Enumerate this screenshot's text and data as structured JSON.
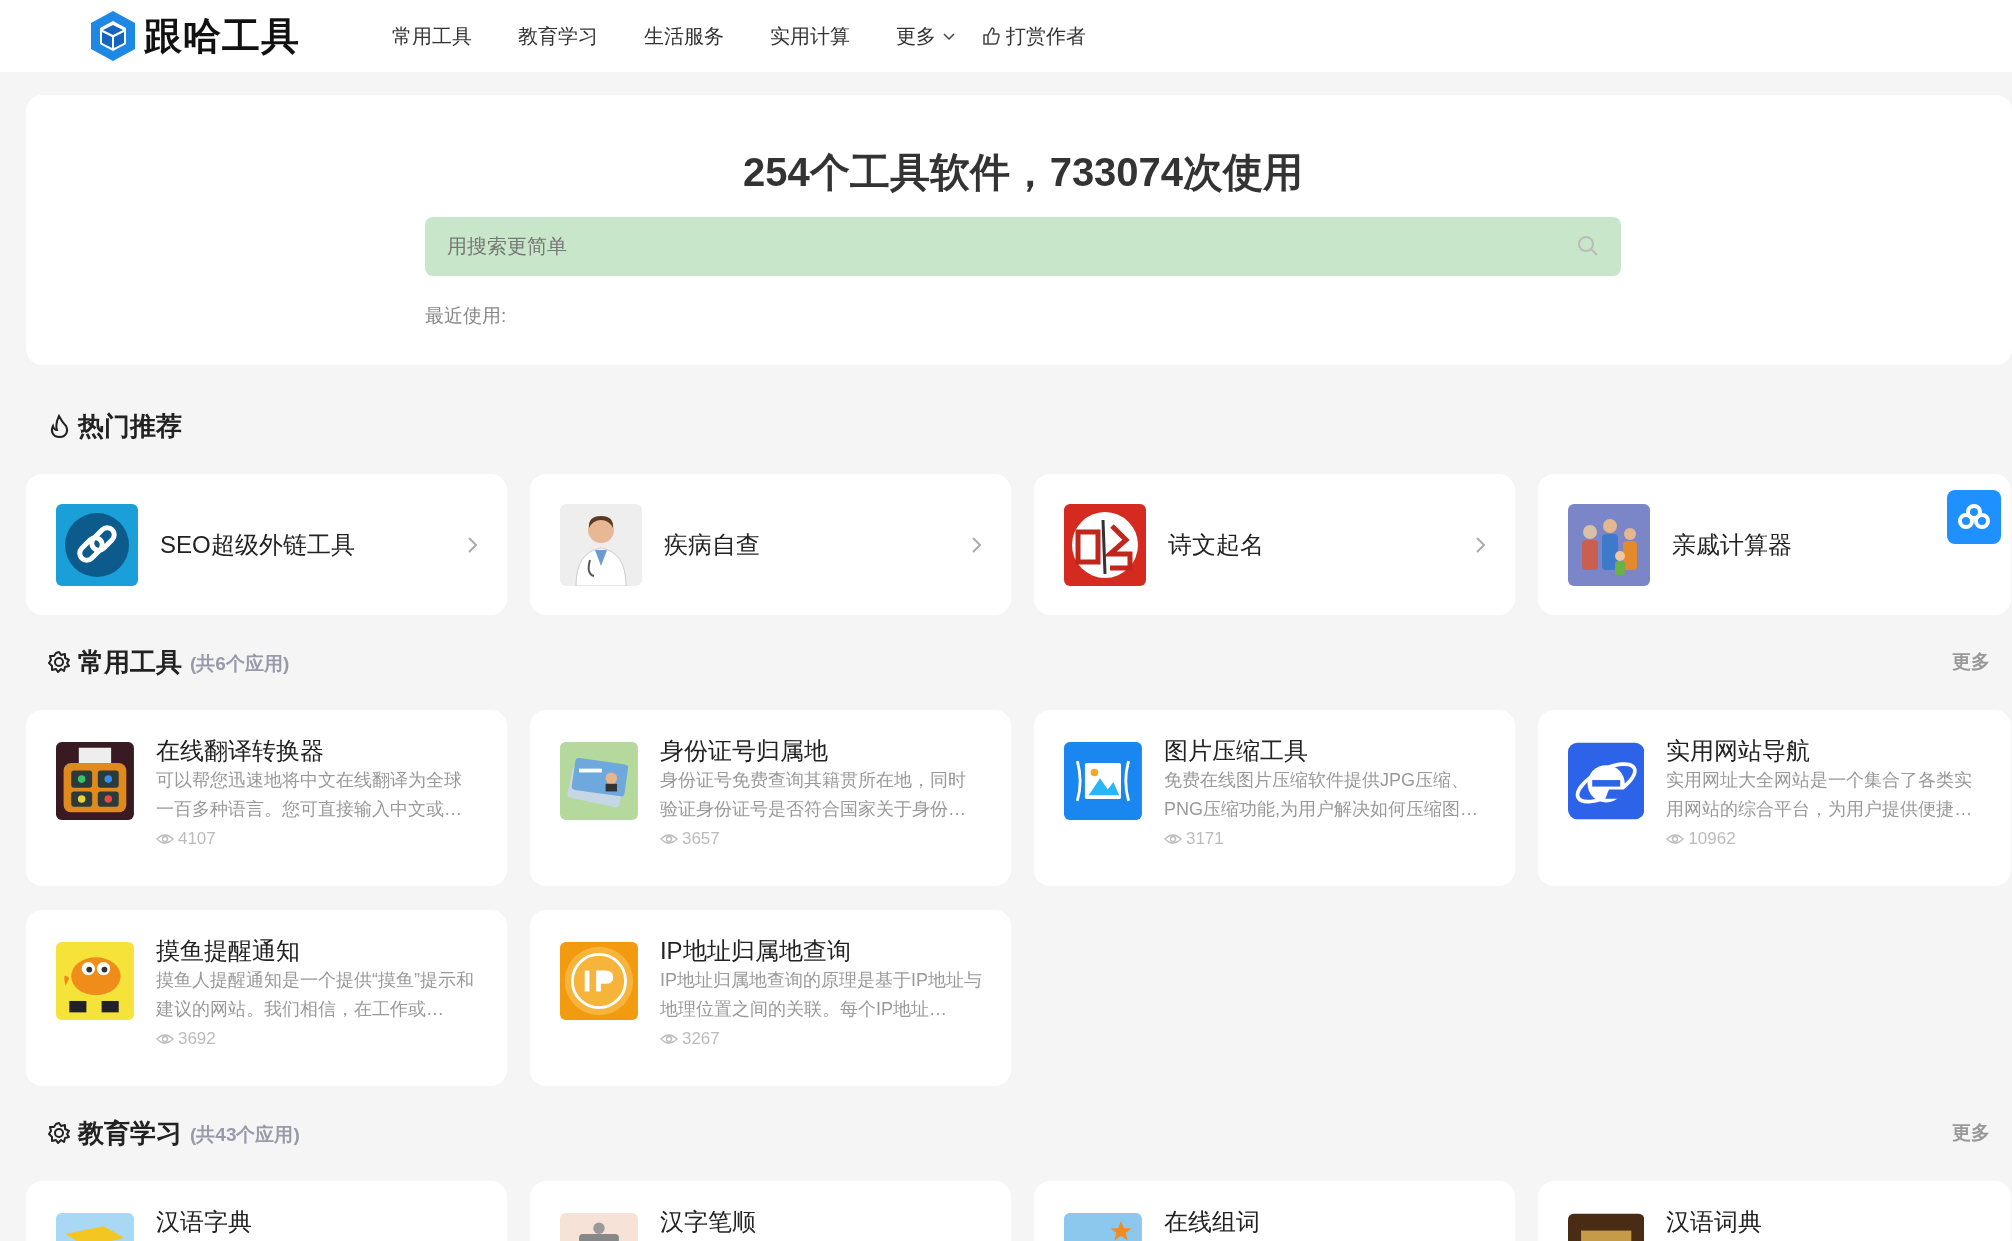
{
  "nav": {
    "logo": "跟哈工具",
    "items": [
      {
        "label": "常用工具",
        "kind": "link"
      },
      {
        "label": "教育学习",
        "kind": "link"
      },
      {
        "label": "生活服务",
        "kind": "link"
      },
      {
        "label": "实用计算",
        "kind": "link"
      },
      {
        "label": "更多",
        "kind": "dropdown"
      },
      {
        "label": "打赏作者",
        "kind": "reward"
      }
    ]
  },
  "hero": {
    "title": "254个工具软件，733074次使用",
    "search": {
      "placeholder": "用搜索更简单"
    },
    "recent_label": "最近使用:"
  },
  "hot": {
    "title": "热门推荐",
    "items": [
      {
        "name": "SEO超级外链工具"
      },
      {
        "name": "疾病自查"
      },
      {
        "name": "诗文起名"
      },
      {
        "name": "亲戚计算器"
      }
    ]
  },
  "sections": [
    {
      "title": "常用工具",
      "count": "(共6个应用)",
      "more": "更多",
      "tools": [
        {
          "name": "在线翻译转换器",
          "desc": "可以帮您迅速地将中文在线翻译为全球一百多种语言。您可直接输入中文或…",
          "views": "4107"
        },
        {
          "name": "身份证号归属地",
          "desc": "身份证号免费查询其籍贯所在地，同时验证身份证号是否符合国家关于身份…",
          "views": "3657"
        },
        {
          "name": "图片压缩工具",
          "desc": "免费在线图片压缩软件提供JPG压缩、PNG压缩功能,为用户解决如何压缩图…",
          "views": "3171"
        },
        {
          "name": "实用网站导航",
          "desc": "实用网址大全网站是一个集合了各类实用网站的综合平台，为用户提供便捷…",
          "views": "10962"
        },
        {
          "name": "摸鱼提醒通知",
          "desc": "摸鱼人提醒通知是一个提供“摸鱼”提示和建议的网站。我们相信，在工作或…",
          "views": "3692"
        },
        {
          "name": "IP地址归属地查询",
          "desc": "IP地址归属地查询的原理是基于IP地址与地理位置之间的关联。每个IP地址…",
          "views": "3267"
        }
      ]
    },
    {
      "title": "教育学习",
      "count": "(共43个应用)",
      "more": "更多",
      "tools": [
        {
          "name": "汉语字典"
        },
        {
          "name": "汉字笔顺"
        },
        {
          "name": "在线组词"
        },
        {
          "name": "汉语词典"
        }
      ]
    }
  ]
}
